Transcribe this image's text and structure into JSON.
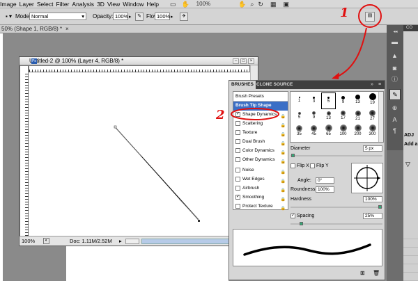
{
  "menubar": {
    "items": [
      "Image",
      "Layer",
      "Select",
      "Filter",
      "Analysis",
      "3D",
      "View",
      "Window",
      "Help"
    ],
    "zoom": "100%",
    "glyphs": [
      "hand-icon",
      "zoom-icon",
      "rotate-icon",
      "grid-icon",
      "screen-mode-icon"
    ]
  },
  "options": {
    "mode_label": "Mode:",
    "mode_value": "Normal",
    "opacity_label": "Opacity:",
    "opacity_value": "100%",
    "flow_label": "Flow:",
    "flow_value": "100%"
  },
  "doc_tab": {
    "title": "50% (Shape 1, RGB/8) *"
  },
  "document": {
    "title": "Untitled-2 @ 100% (Layer 4, RGB/8) *",
    "zoom": "100%",
    "doc_info": "Doc: 1.11M/2.52M"
  },
  "brushes": {
    "tabs": [
      "BRUSHES",
      "CLONE SOURCE"
    ],
    "presets_label": "Brush Presets",
    "list": [
      {
        "label": "Brush Tip Shape",
        "checked": null,
        "selected": true
      },
      {
        "label": "Shape Dynamics",
        "checked": true,
        "selected": false
      },
      {
        "label": "Scattering",
        "checked": false,
        "selected": false
      },
      {
        "label": "Texture",
        "checked": false,
        "selected": false
      },
      {
        "label": "Dual Brush",
        "checked": false,
        "selected": false
      },
      {
        "label": "Color Dynamics",
        "checked": false,
        "selected": false
      },
      {
        "label": "Other Dynamics",
        "checked": false,
        "selected": false
      },
      {
        "label": "Noise",
        "checked": false,
        "selected": false
      },
      {
        "label": "Wet Edges",
        "checked": false,
        "selected": false
      },
      {
        "label": "Airbrush",
        "checked": false,
        "selected": false
      },
      {
        "label": "Smoothing",
        "checked": true,
        "selected": false
      },
      {
        "label": "Protect Texture",
        "checked": false,
        "selected": false
      }
    ],
    "tips_row1": [
      "1",
      "3",
      "5",
      "9",
      "13",
      "19"
    ],
    "tips_row2": [
      "5",
      "9",
      "13",
      "17",
      "21",
      "27"
    ],
    "tips_row3": [
      "35",
      "45",
      "65",
      "100",
      "200",
      "300"
    ],
    "diameter_label": "Diameter",
    "diameter_value": "5 px",
    "flipx_label": "Flip X",
    "flipy_label": "Flip Y",
    "angle_label": "Angle:",
    "angle_value": "0°",
    "roundness_label": "Roundness:",
    "roundness_value": "100%",
    "hardness_label": "Hardness",
    "hardness_value": "100%",
    "spacing_label": "Spacing",
    "spacing_value": "25%"
  },
  "dock": {
    "adj_label": "ADJ",
    "add_label": "Add a"
  },
  "annotations": {
    "one": "1",
    "two": "2"
  },
  "colors": {
    "accent_red": "#e01010",
    "selected_blue": "#3b6fc6"
  }
}
